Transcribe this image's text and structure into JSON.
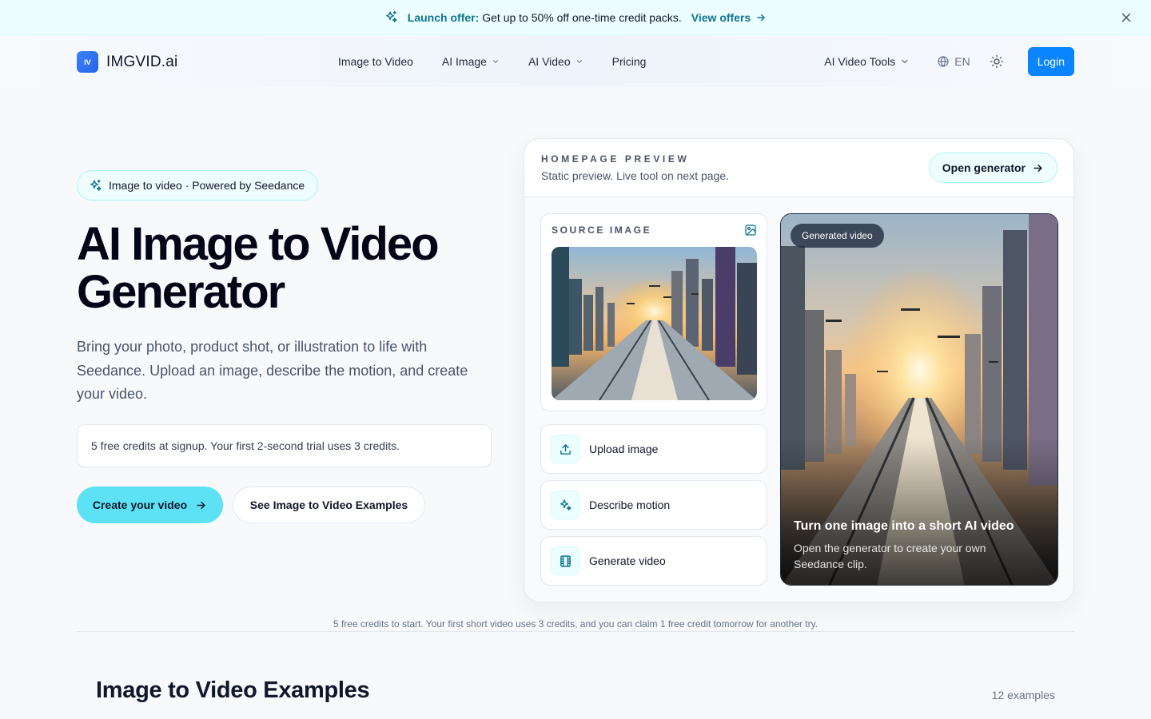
{
  "promo": {
    "lead": "Launch offer:",
    "text": "Get up to 50% off one-time credit packs.",
    "link": "View offers"
  },
  "nav": {
    "brand_mark": "IV",
    "brand": "IMGVID.ai",
    "items": [
      "Image to Video",
      "AI Image",
      "AI Video",
      "Pricing"
    ],
    "tools": "AI Video Tools",
    "lang": "EN",
    "login": "Login"
  },
  "hero": {
    "badge": "Image to video · Powered by Seedance",
    "title": "AI Image to Video Generator",
    "subtitle": "Bring your photo, product shot, or illustration to life with Seedance. Upload an image, describe the motion, and create your video.",
    "credits": "5 free credits at signup. Your first 2-second trial uses 3 credits.",
    "cta_primary": "Create your video",
    "cta_secondary": "See Image to Video Examples"
  },
  "preview": {
    "eyebrow": "HOMEPAGE PREVIEW",
    "desc": "Static preview. Live tool on next page.",
    "open": "Open generator",
    "source_label": "SOURCE IMAGE",
    "steps": [
      "Upload image",
      "Describe motion",
      "Generate video"
    ],
    "video_tag": "Generated video",
    "video_title": "Turn one image into a short AI video",
    "video_desc": "Open the generator to create your own Seedance clip."
  },
  "footnote": "5 free credits to start. Your first short video uses 3 credits, and you can claim 1 free credit tomorrow for another try.",
  "examples": {
    "title": "Image to Video Examples",
    "count": "12 examples"
  },
  "colors": {
    "accent": "#0e7490",
    "primary_button": "#0a84ff",
    "cta": "#5ce1f5"
  }
}
